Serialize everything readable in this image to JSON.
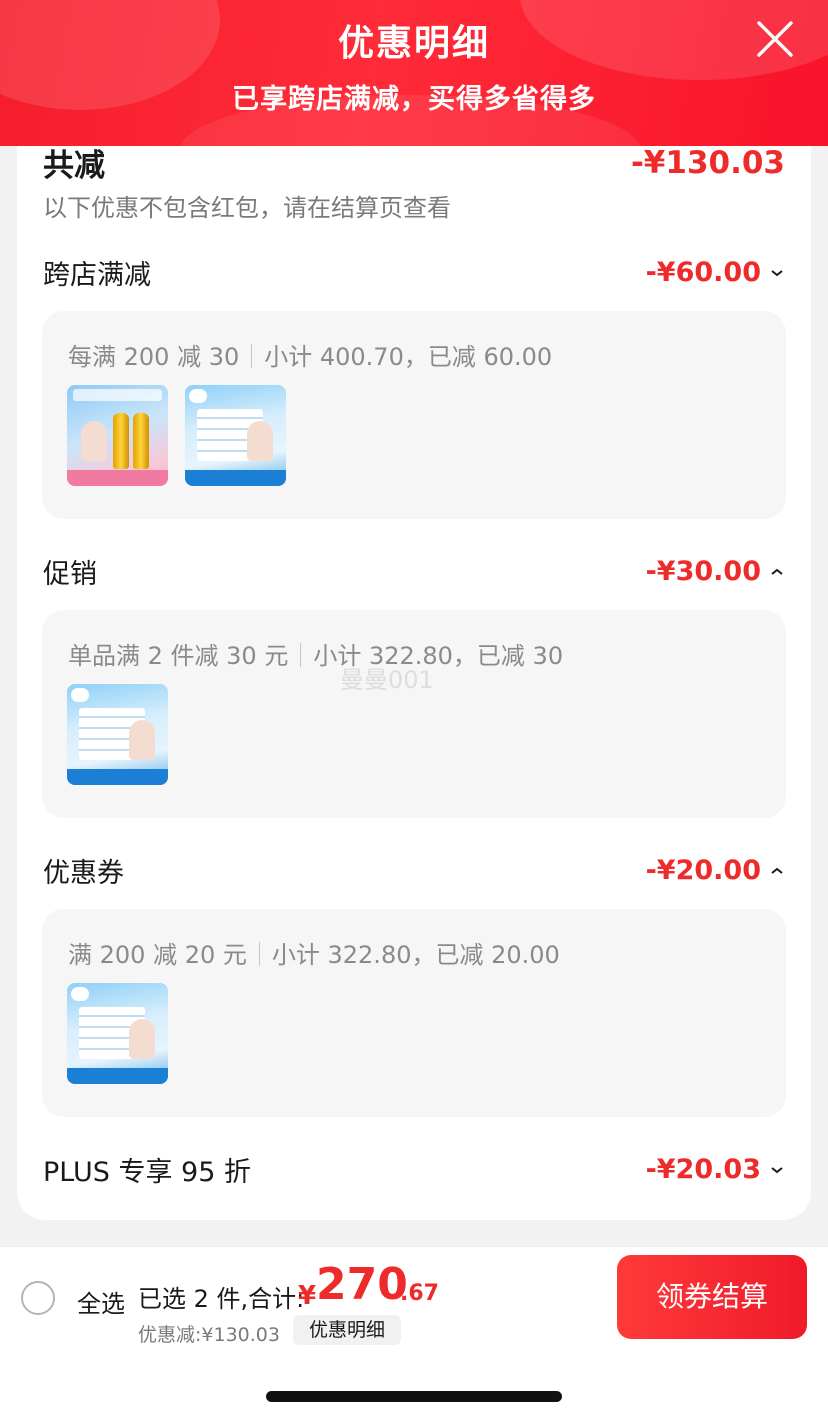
{
  "header": {
    "title": "优惠明细",
    "subtitle": "已享跨店满减，买得多省得多"
  },
  "summary": {
    "total_label": "共减",
    "total_amount": "-¥130.03",
    "note": "以下优惠不包含红包，请在结算页查看"
  },
  "sections": [
    {
      "label": "跨店满减",
      "amount": "-¥60.00",
      "expanded": false,
      "rule": "每满 200 减 30",
      "subtotal": "小计 400.70，已减 60.00",
      "products": [
        "sunscreen-spray",
        "facial-tissue-pack"
      ]
    },
    {
      "label": "促销",
      "amount": "-¥30.00",
      "expanded": true,
      "rule": "单品满 2 件减 30 元",
      "subtotal": "小计 322.80，已减 30",
      "products": [
        "facial-tissue-pack"
      ]
    },
    {
      "label": "优惠券",
      "amount": "-¥20.00",
      "expanded": true,
      "rule": "满 200 减 20 元",
      "subtotal": "小计 322.80，已减 20.00",
      "products": [
        "facial-tissue-pack"
      ]
    },
    {
      "label": "PLUS 专享 95 折",
      "amount": "-¥20.03",
      "expanded": false
    }
  ],
  "watermark": "曼曼001",
  "footer": {
    "select_all": "全选",
    "selected_text": "已选 2 件,合计:",
    "currency": "¥",
    "total_int": "270",
    "total_dec": ".67",
    "discount_text": "优惠减:¥130.03",
    "detail_button": "优惠明细",
    "checkout_button": "领券结算"
  },
  "colors": {
    "accent_red": "#ee2b2b",
    "header_red": "#f51d2c"
  }
}
